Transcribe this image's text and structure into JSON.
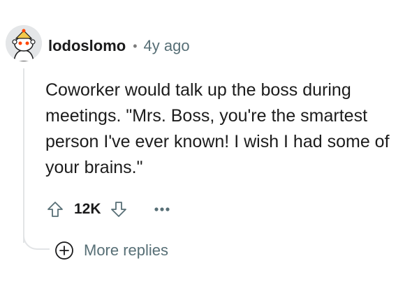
{
  "comment": {
    "author": "lodoslomo",
    "separator": "•",
    "age": "4y ago",
    "body": "Coworker would talk up the boss during meetings. \"Mrs. Boss, you're the smartest person I've ever known! I wish I had some of your brains.\"",
    "score": "12K",
    "icons": {
      "upvote": "upvote-arrow-icon",
      "downvote": "downvote-arrow-icon",
      "overflow": "more-options-icon",
      "expand": "plus-circle-icon",
      "avatar": "snoo-avatar"
    }
  },
  "thread": {
    "more_replies_label": "More replies"
  }
}
